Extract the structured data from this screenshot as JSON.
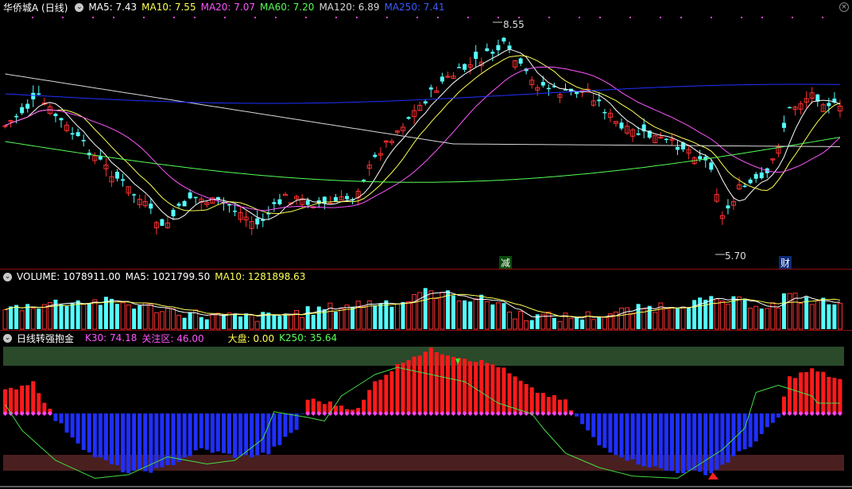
{
  "price_panel": {
    "title": "华侨城A (日线)",
    "menu_icon": "chevron-down-icon",
    "indicators": [
      {
        "label": "MA5: 7.43",
        "color": "#ffffff"
      },
      {
        "label": "MA10: 7.55",
        "color": "#ffff55"
      },
      {
        "label": "MA20: 7.07",
        "color": "#ff55ff"
      },
      {
        "label": "MA60: 7.20",
        "color": "#55ff55"
      },
      {
        "label": "MA120: 6.89",
        "color": "#d8d8d8"
      },
      {
        "label": "MA250: 7.41",
        "color": "#3b5bff"
      }
    ],
    "high_label": "8.55",
    "low_label": "5.70",
    "event_tag_1": "减",
    "event_tag_2": "财",
    "close_icon": "close-icon"
  },
  "volume_panel": {
    "title": "VOLUME: 1078911.00",
    "ma5": "MA5: 1021799.50",
    "ma10": "MA10: 1281898.63"
  },
  "signal_panel": {
    "title": "日线转强抱金",
    "k30": "K30: 74.18",
    "focus": "关注区: 46.00",
    "market": "大盘: 0.00",
    "k250": "K250: 35.64"
  },
  "colors": {
    "up": "#ff3232",
    "down": "#54ffff",
    "red_bar": "#ff1a1a",
    "blue_bar": "#1f2fff",
    "green_zone": "#2a4a2a",
    "brown_zone": "#4a1f1f",
    "magenta_dots": "#ff44ff"
  }
}
